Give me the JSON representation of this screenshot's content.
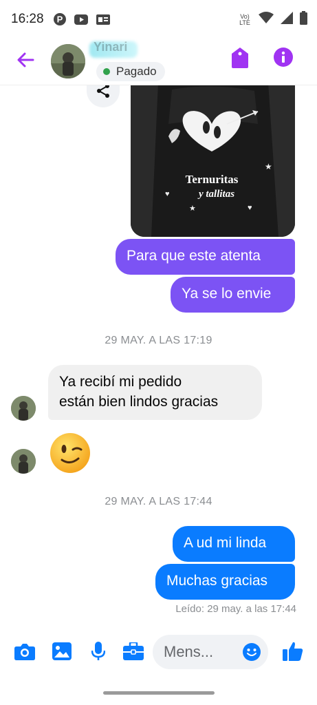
{
  "status_bar": {
    "time": "16:28",
    "network": "Vo) LTE"
  },
  "header": {
    "contact_name": "Yinari",
    "badge_label": "Pagado",
    "accent_color": "#a033f2"
  },
  "messages": {
    "out_purple_1": "Para que este atenta",
    "out_purple_2": "Ya se lo envie",
    "timestamp_1": "29 MAY. A LAS 17:19",
    "incoming_1_line1": "Ya recibí mi pedido",
    "incoming_1_line2": "están bien lindos gracias",
    "timestamp_2": "29 MAY. A LAS 17:44",
    "out_blue_1": "A ud mi linda",
    "out_blue_2": "Muchas gracias",
    "read_receipt": "Leído: 29 may. a las 17:44"
  },
  "image_print": {
    "brand_line1": "Ternuritas",
    "brand_line2": "y tallitas"
  },
  "composer": {
    "placeholder": "Mens..."
  },
  "colors": {
    "purple_bubble": "#7c53f4",
    "blue_bubble": "#0a7cff",
    "icon_blue": "#0a7cff"
  }
}
